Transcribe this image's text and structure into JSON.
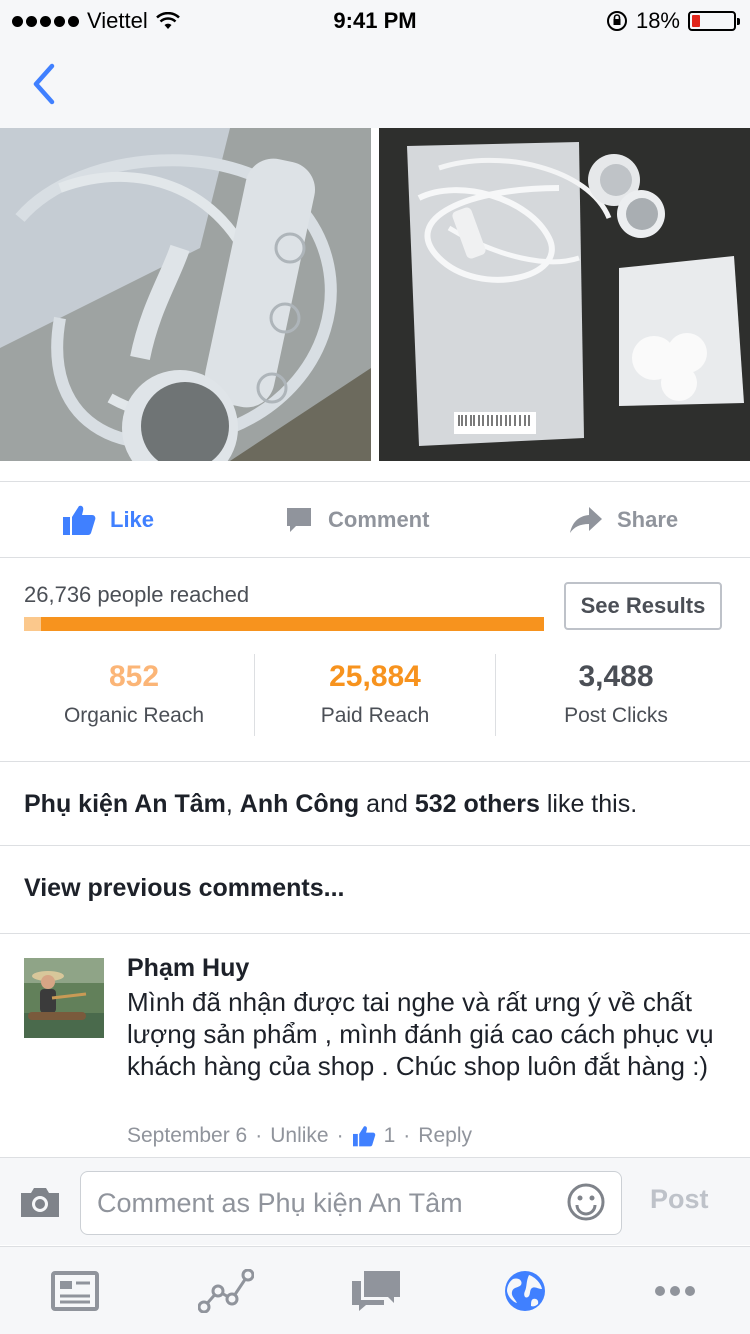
{
  "status_bar": {
    "carrier": "Viettel",
    "time": "9:41 PM",
    "battery": "18%",
    "battery_level": 0.18
  },
  "nav": {
    "back_icon": "chevron-left-icon"
  },
  "actions": {
    "like": "Like",
    "comment": "Comment",
    "share": "Share"
  },
  "reach": {
    "label": "26,736 people reached",
    "organic_fraction": 0.032,
    "see_results": "See Results",
    "stats": [
      {
        "value": "852",
        "label": "Organic Reach",
        "color": "#fbb577"
      },
      {
        "value": "25,884",
        "label": "Paid Reach",
        "color": "#f7931e"
      },
      {
        "value": "3,488",
        "label": "Post Clicks",
        "color": "#4b4f56"
      }
    ]
  },
  "likes": {
    "name1": "Phụ kiện An Tâm",
    "sep1": ", ",
    "name2": "Anh Công",
    "and": " and ",
    "others": "532 others",
    "suffix": " like this."
  },
  "view_previous": "View previous comments...",
  "comment": {
    "author": "Phạm Huy",
    "text": "Mình đã nhận được tai nghe và rất ưng ý về chất lượng sản phẩm , mình đánh giá cao cách phục vụ khách hàng của shop . Chúc shop luôn đắt hàng :)",
    "date": "September 6",
    "unlike": "Unlike",
    "like_count": "1",
    "reply": "Reply"
  },
  "composer": {
    "placeholder": "Comment as Phụ kiện An Tâm",
    "post": "Post"
  },
  "colors": {
    "accent": "#4080ff",
    "orange": "#f7931e",
    "light_orange": "#fbc88c"
  },
  "tabs": [
    "news-feed-icon",
    "insights-icon",
    "messages-icon",
    "globe-icon",
    "more-icon"
  ]
}
